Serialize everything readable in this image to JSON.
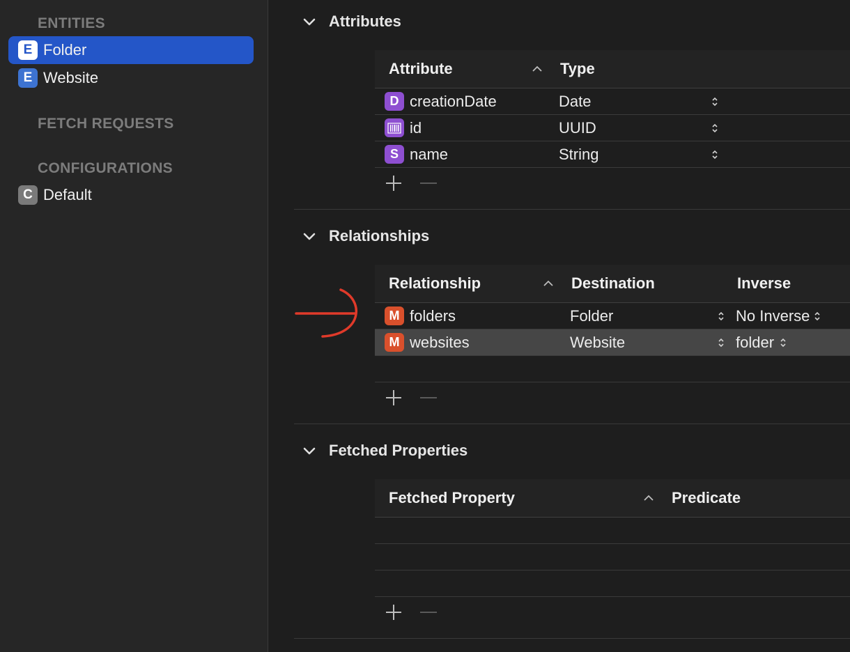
{
  "sidebar": {
    "entities_header": "ENTITIES",
    "entities": [
      {
        "badge": "E",
        "label": "Folder",
        "selected": true
      },
      {
        "badge": "E",
        "label": "Website",
        "selected": false
      }
    ],
    "fetch_requests_header": "FETCH REQUESTS",
    "configurations_header": "CONFIGURATIONS",
    "configurations": [
      {
        "badge": "C",
        "label": "Default"
      }
    ]
  },
  "attributes": {
    "title": "Attributes",
    "headers": {
      "name": "Attribute",
      "type": "Type"
    },
    "rows": [
      {
        "badge": "D",
        "name": "creationDate",
        "type": "Date"
      },
      {
        "badge": "barcode",
        "name": "id",
        "type": "UUID"
      },
      {
        "badge": "S",
        "name": "name",
        "type": "String"
      }
    ]
  },
  "relationships": {
    "title": "Relationships",
    "headers": {
      "name": "Relationship",
      "destination": "Destination",
      "inverse": "Inverse"
    },
    "rows": [
      {
        "badge": "M",
        "name": "folders",
        "destination": "Folder",
        "inverse": "No Inverse"
      },
      {
        "badge": "M",
        "name": "websites",
        "destination": "Website",
        "inverse": "folder"
      }
    ]
  },
  "fetched_properties": {
    "title": "Fetched Properties",
    "headers": {
      "name": "Fetched Property",
      "predicate": "Predicate"
    }
  },
  "colors": {
    "selection_blue": "#2456c8",
    "entity_badge": "#3d73d1",
    "attribute_badge": "#8e4fd1",
    "relationship_badge": "#d9502c",
    "annotation_red": "#e03a2a"
  }
}
